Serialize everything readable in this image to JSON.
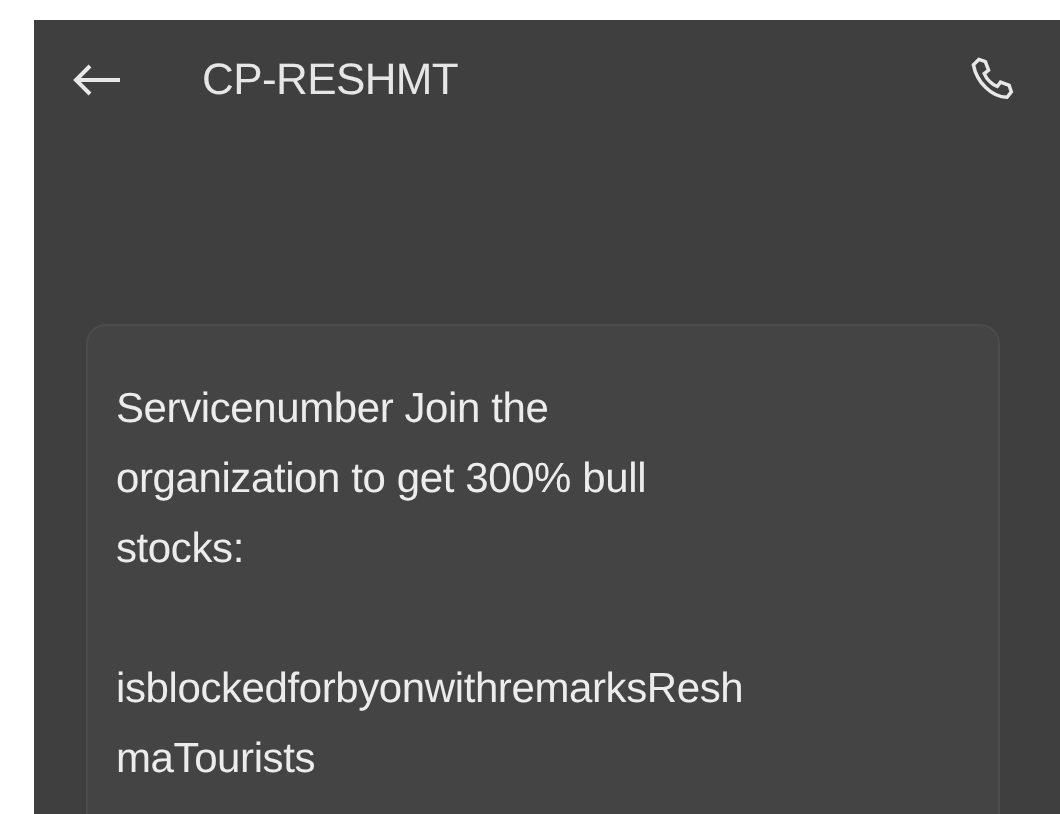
{
  "header": {
    "title": "CP-RESHMT"
  },
  "message": {
    "text": "Servicenumber Join the\norganization to get 300% bull\nstocks:\n\nisblockedforbyonwithremarksResh\nmaTourists"
  }
}
